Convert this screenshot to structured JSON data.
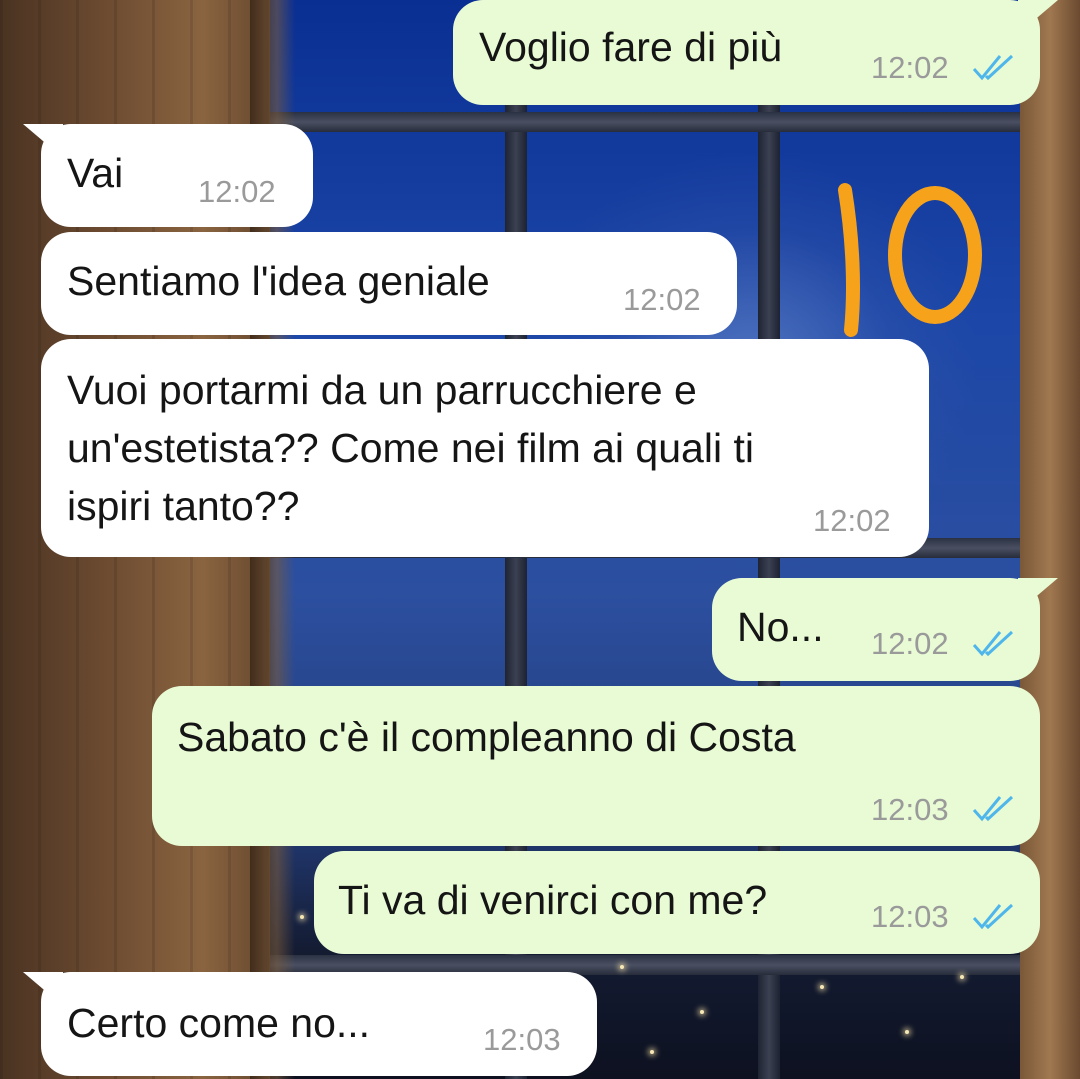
{
  "colors": {
    "incoming_bubble": "#ffffff",
    "outgoing_bubble": "#e8fbd5",
    "read_ticks": "#4fb6ec",
    "timestamp": "#9a9a9a",
    "annotation": "#f7a21b"
  },
  "annotation": {
    "label": "10"
  },
  "messages": [
    {
      "direction": "outgoing",
      "text": "Voglio fare di più",
      "time": "12:02",
      "status_icon": "double-check-read-icon"
    },
    {
      "direction": "incoming",
      "text": "Vai",
      "time": "12:02"
    },
    {
      "direction": "incoming",
      "text": "Sentiamo l'idea geniale",
      "time": "12:02"
    },
    {
      "direction": "incoming",
      "text": "Vuoi portarmi da un parrucchiere e\nun'estetista?? Come nei film ai quali ti\nispiri tanto??",
      "time": "12:02"
    },
    {
      "direction": "outgoing",
      "text": "No...",
      "time": "12:02",
      "status_icon": "double-check-read-icon"
    },
    {
      "direction": "outgoing",
      "text": "Sabato c'è il compleanno di Costa",
      "time": "12:03",
      "status_icon": "double-check-read-icon"
    },
    {
      "direction": "outgoing",
      "text": "Ti va di venirci con me?",
      "time": "12:03",
      "status_icon": "double-check-read-icon"
    },
    {
      "direction": "incoming",
      "text": "Certo come no...",
      "time": "12:03"
    }
  ]
}
